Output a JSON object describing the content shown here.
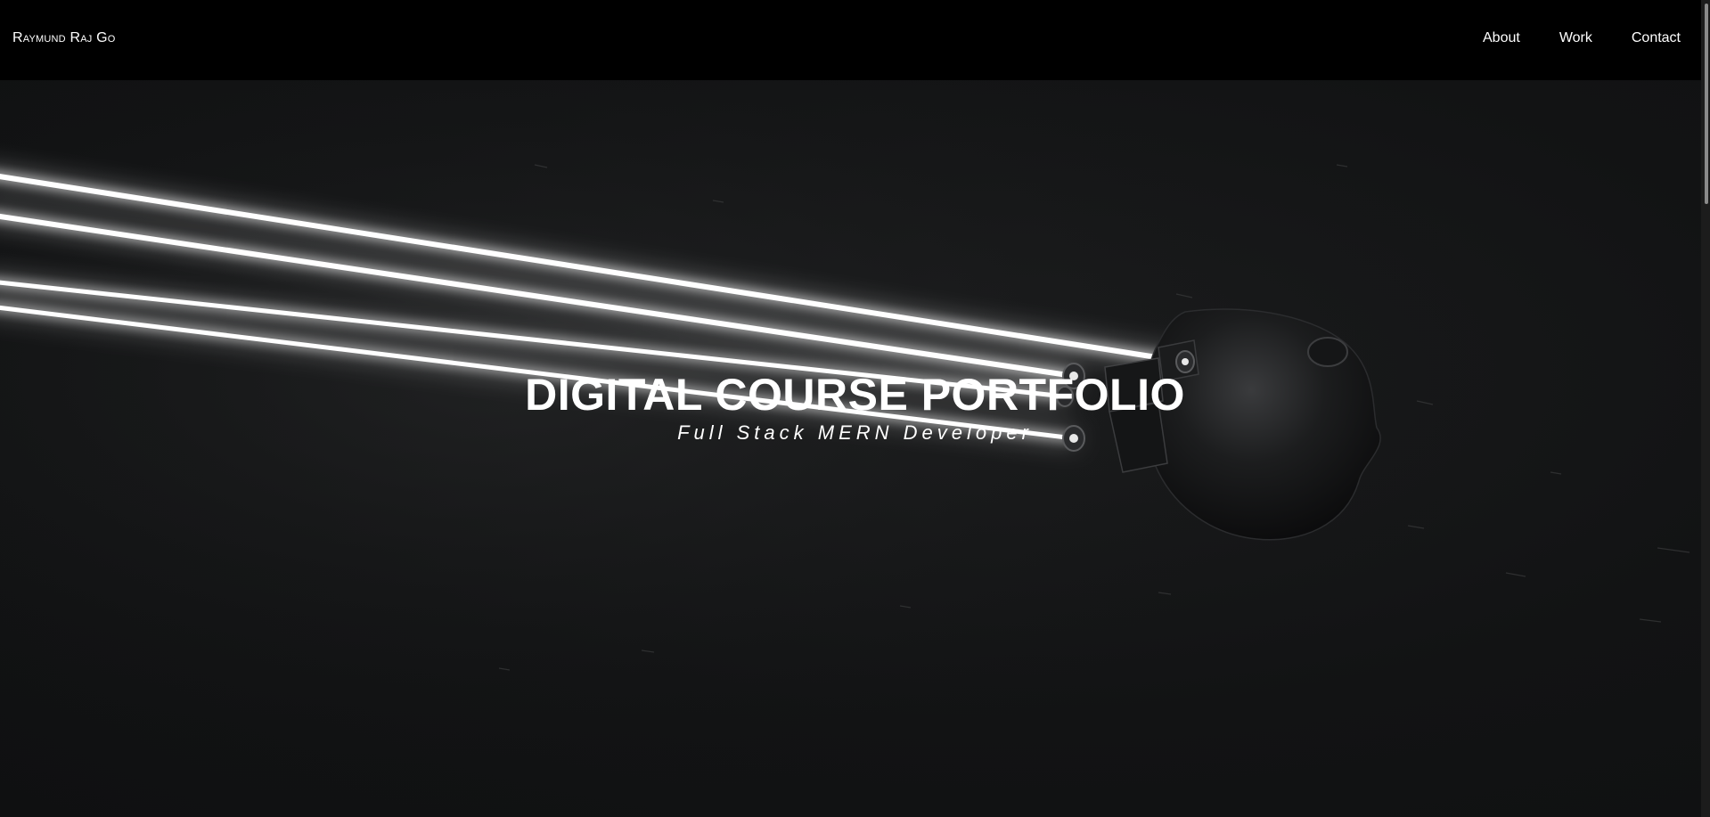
{
  "navbar": {
    "brand": "Raymund Raj Go",
    "links": [
      {
        "label": "About"
      },
      {
        "label": "Work"
      },
      {
        "label": "Contact"
      }
    ]
  },
  "hero": {
    "title": "DIGITAL COURSE PORTFOLIO",
    "subtitle": "Full Stack MERN Developer"
  },
  "colors": {
    "navbar_bg": "#000000",
    "hero_bg": "#111213",
    "text": "#ffffff",
    "beam": "#ffffff"
  }
}
